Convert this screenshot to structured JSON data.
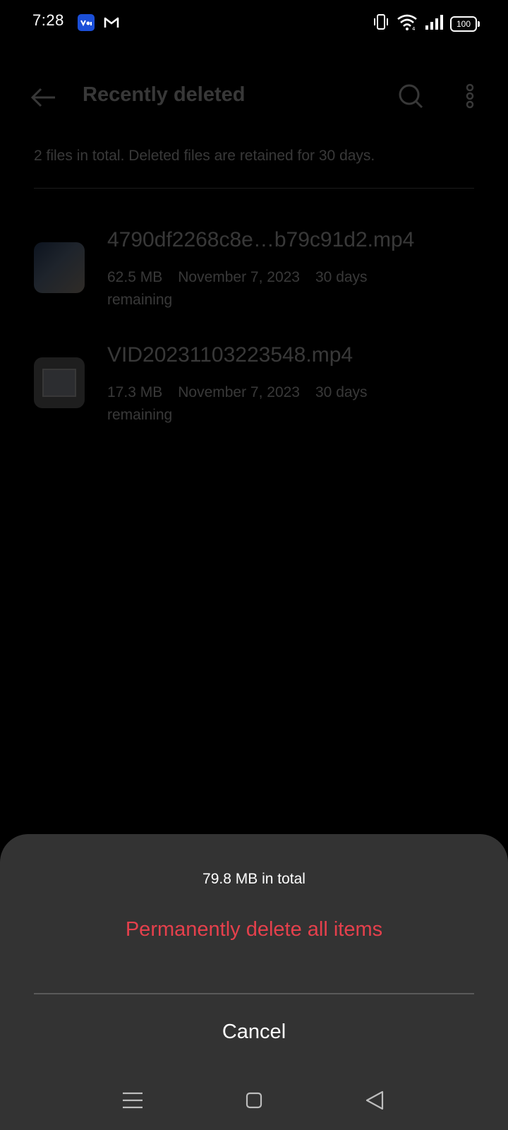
{
  "status_bar": {
    "time": "7:28",
    "battery": "100",
    "icons": [
      "notification-app-icon",
      "gmail-icon",
      "vibrate-icon",
      "wifi-icon",
      "signal-icon",
      "battery-icon"
    ]
  },
  "app_bar": {
    "title": "Recently deleted",
    "back_icon": "arrow-left-icon",
    "search_icon": "search-icon",
    "more_icon": "more-vertical-icon"
  },
  "summary": {
    "text": "2 files in total. Deleted files are retained for 30 days."
  },
  "files": [
    {
      "name": "4790df2268c8e…b79c91d2.mp4",
      "size": "62.5 MB",
      "date": "November 7, 2023",
      "remaining_part1": "30 days",
      "remaining_part2": "remaining"
    },
    {
      "name": "VID20231103223548.mp4",
      "size": "17.3 MB",
      "date": "November 7, 2023",
      "remaining_part1": "30 days",
      "remaining_part2": "remaining"
    }
  ],
  "sheet": {
    "total": "79.8 MB in total",
    "delete_all_label": "Permanently delete all items",
    "cancel_label": "Cancel"
  },
  "nav_bar": {
    "icons": [
      "menu-icon",
      "home-icon",
      "back-triangle-icon"
    ]
  },
  "colors": {
    "background": "#000000",
    "sheet": "#333333",
    "destructive": "#e5404c",
    "text": "#ffffff"
  }
}
